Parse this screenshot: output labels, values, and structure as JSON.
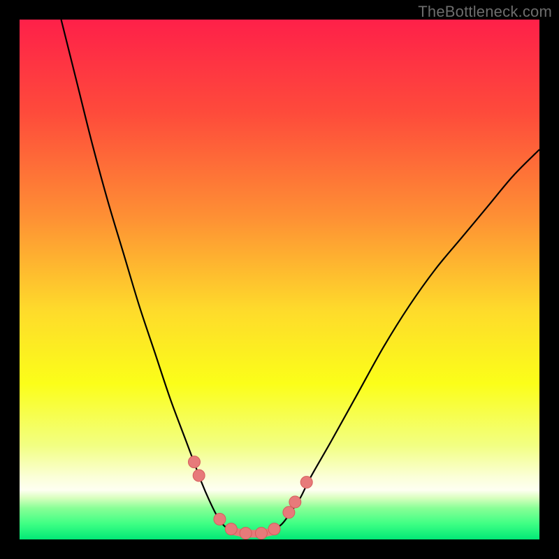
{
  "watermark": "TheBottleneck.com",
  "chart_data": {
    "type": "line",
    "title": "",
    "xlabel": "",
    "ylabel": "",
    "xlim": [
      0,
      100
    ],
    "ylim": [
      0,
      100
    ],
    "grid": false,
    "legend": false,
    "series": [
      {
        "name": "curve-left",
        "x": [
          8,
          11,
          14,
          17,
          20,
          23,
          26,
          29,
          32,
          33.5,
          35,
          36.5,
          38,
          39.5,
          41.5
        ],
        "y": [
          100,
          88,
          76,
          65,
          55,
          45,
          36,
          27,
          19,
          15,
          11,
          7.5,
          4.5,
          2.5,
          1.5
        ]
      },
      {
        "name": "curve-right",
        "x": [
          48.5,
          50.5,
          52,
          54,
          56,
          60,
          65,
          70,
          75,
          80,
          85,
          90,
          95,
          100
        ],
        "y": [
          1.5,
          3,
          5,
          8,
          12,
          19,
          28,
          37,
          45,
          52,
          58,
          64,
          70,
          75
        ]
      },
      {
        "name": "valley-flat",
        "x": [
          41.5,
          43,
          45,
          47,
          48.5
        ],
        "y": [
          1.5,
          1.2,
          1.1,
          1.2,
          1.5
        ]
      }
    ],
    "markers": [
      {
        "name": "dot-left-upper",
        "x": 33.6,
        "y": 14.9
      },
      {
        "name": "dot-left-lower",
        "x": 34.5,
        "y": 12.3
      },
      {
        "name": "dot-valley-1",
        "x": 38.5,
        "y": 3.9
      },
      {
        "name": "dot-valley-2",
        "x": 40.7,
        "y": 2.0
      },
      {
        "name": "dot-valley-3",
        "x": 43.5,
        "y": 1.2
      },
      {
        "name": "dot-valley-4",
        "x": 46.5,
        "y": 1.2
      },
      {
        "name": "dot-valley-5",
        "x": 49.0,
        "y": 2.0
      },
      {
        "name": "dot-right-lower",
        "x": 51.8,
        "y": 5.2
      },
      {
        "name": "dot-right-mid",
        "x": 53.0,
        "y": 7.2
      },
      {
        "name": "dot-right-upper",
        "x": 55.2,
        "y": 11.0
      }
    ],
    "gradient_stops": [
      {
        "pos": 0.0,
        "color": "#fe2049"
      },
      {
        "pos": 0.18,
        "color": "#fe4b3b"
      },
      {
        "pos": 0.38,
        "color": "#fe9034"
      },
      {
        "pos": 0.56,
        "color": "#fedb2b"
      },
      {
        "pos": 0.7,
        "color": "#fbfe19"
      },
      {
        "pos": 0.82,
        "color": "#f2ff83"
      },
      {
        "pos": 0.88,
        "color": "#fbffd8"
      },
      {
        "pos": 0.905,
        "color": "#fefff2"
      },
      {
        "pos": 0.92,
        "color": "#d9ffbf"
      },
      {
        "pos": 0.94,
        "color": "#88ff96"
      },
      {
        "pos": 0.97,
        "color": "#3eff84"
      },
      {
        "pos": 1.0,
        "color": "#02e876"
      }
    ],
    "colors": {
      "marker_fill": "#e77a7a",
      "marker_stroke": "#d65c5c",
      "valley_stroke": "#e77a7a",
      "curve_stroke": "#000000"
    }
  }
}
